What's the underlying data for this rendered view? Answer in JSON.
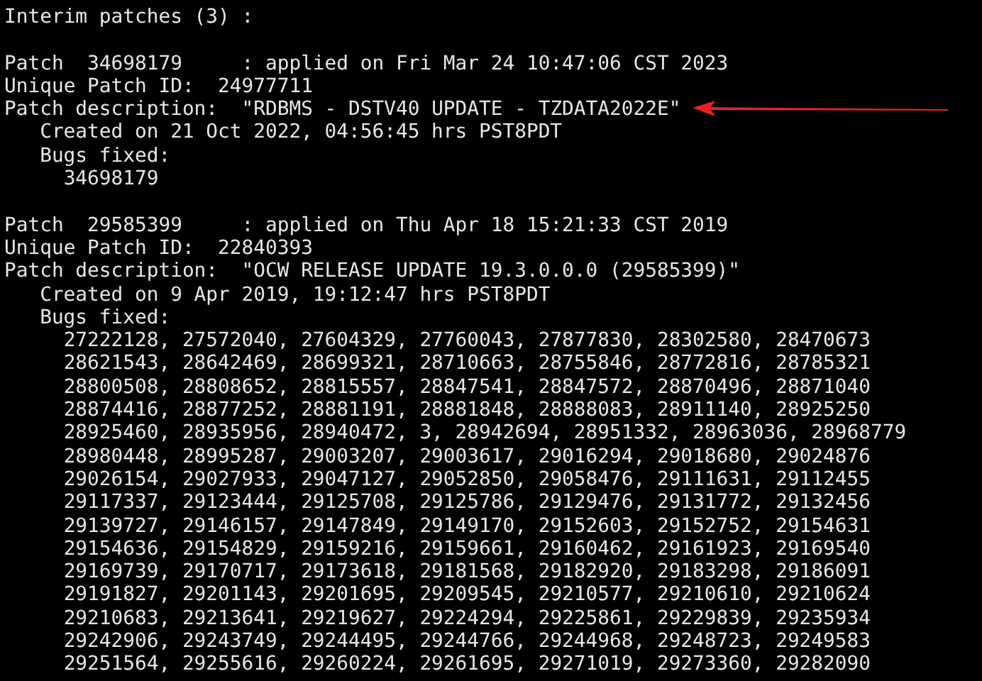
{
  "header": "Interim patches (3) :",
  "patches": [
    {
      "highlighted": true,
      "applied": "Patch  34698179     : applied on Fri Mar 24 10:47:06 CST 2023",
      "unique_id": "Unique Patch ID:  24977711",
      "description": "Patch description:  \"RDBMS - DSTV40 UPDATE - TZDATA2022E\"",
      "created": "Created on 21 Oct 2022, 04:56:45 hrs PST8PDT",
      "bugs_label": "Bugs fixed:",
      "bugs": [
        "34698179"
      ]
    },
    {
      "highlighted": false,
      "applied": "Patch  29585399     : applied on Thu Apr 18 15:21:33 CST 2019",
      "unique_id": "Unique Patch ID:  22840393",
      "description": "Patch description:  \"OCW RELEASE UPDATE 19.3.0.0.0 (29585399)\"",
      "created": "Created on 9 Apr 2019, 19:12:47 hrs PST8PDT",
      "bugs_label": "Bugs fixed:",
      "bugs": [
        "27222128, 27572040, 27604329, 27760043, 27877830, 28302580, 28470673",
        "28621543, 28642469, 28699321, 28710663, 28755846, 28772816, 28785321",
        "28800508, 28808652, 28815557, 28847541, 28847572, 28870496, 28871040",
        "28874416, 28877252, 28881191, 28881848, 28888083, 28911140, 28925250",
        "28925460, 28935956, 28940472, 3, 28942694, 28951332, 28963036, 28968779",
        "28980448, 28995287, 29003207, 29003617, 29016294, 29018680, 29024876",
        "29026154, 29027933, 29047127, 29052850, 29058476, 29111631, 29112455",
        "29117337, 29123444, 29125708, 29125786, 29129476, 29131772, 29132456",
        "29139727, 29146157, 29147849, 29149170, 29152603, 29152752, 29154631",
        "29154636, 29154829, 29159216, 29159661, 29160462, 29161923, 29169540",
        "29169739, 29170717, 29173618, 29181568, 29182920, 29183298, 29186091",
        "29191827, 29201143, 29201695, 29209545, 29210577, 29210610, 29210624",
        "29210683, 29213641, 29219627, 29224294, 29225861, 29229839, 29235934",
        "29242906, 29243749, 29244495, 29244766, 29244968, 29248723, 29249583",
        "29251564, 29255616, 29260224, 29261695, 29271019, 29273360, 29282090"
      ]
    }
  ]
}
